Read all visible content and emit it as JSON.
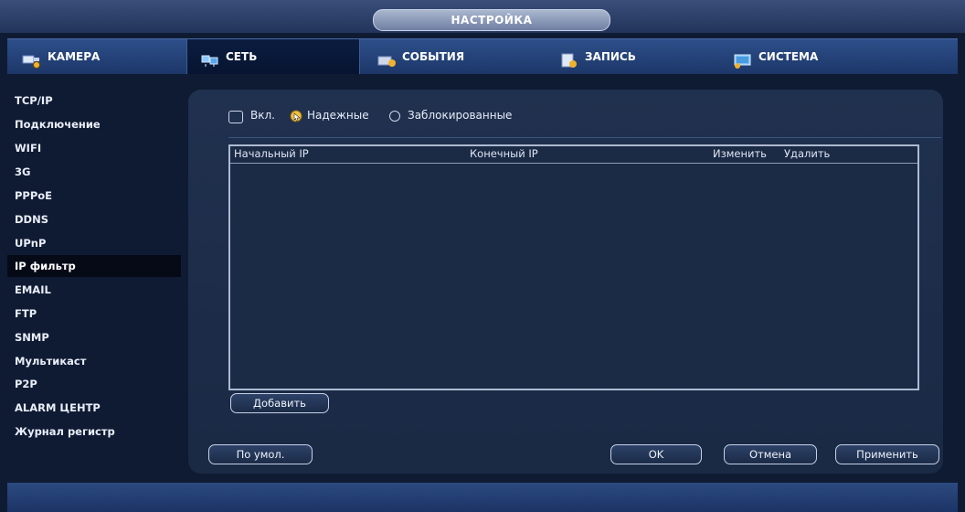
{
  "window": {
    "title": "НАСТРОЙКА"
  },
  "tabs": [
    {
      "label": "КАМЕРА",
      "icon": "camera-icon"
    },
    {
      "label": "СЕТЬ",
      "icon": "network-icon"
    },
    {
      "label": "СОБЫТИЯ",
      "icon": "events-icon"
    },
    {
      "label": "ЗАПИСЬ",
      "icon": "record-icon"
    },
    {
      "label": "СИСТЕМА",
      "icon": "system-icon"
    }
  ],
  "active_tab": "СЕТЬ",
  "sidebar": {
    "items": [
      "TCP/IP",
      "Подключение",
      "WIFI",
      "3G",
      "PPPoE",
      "DDNS",
      "UPnP",
      "IP фильтр",
      "EMAIL",
      "FTP",
      "SNMP",
      "Мультикаст",
      "P2P",
      "ALARM ЦЕНТР",
      "Журнал регистр"
    ],
    "active": "IP фильтр"
  },
  "filter": {
    "enable_label": "Вкл.",
    "trusted_label": "Надежные",
    "blocked_label": "Заблокированные",
    "enabled": false,
    "selected_mode": "Надежные"
  },
  "table": {
    "columns": [
      "Начальный IP",
      "Конечный IP",
      "Изменить",
      "Удалить"
    ],
    "rows": []
  },
  "buttons": {
    "add": "Добавить",
    "default": "По умол.",
    "ok": "OK",
    "cancel": "Отмена",
    "apply": "Применить"
  },
  "colors": {
    "accent": "#2d4f8a",
    "background": "#0f1b33",
    "panel": "#20314f"
  }
}
